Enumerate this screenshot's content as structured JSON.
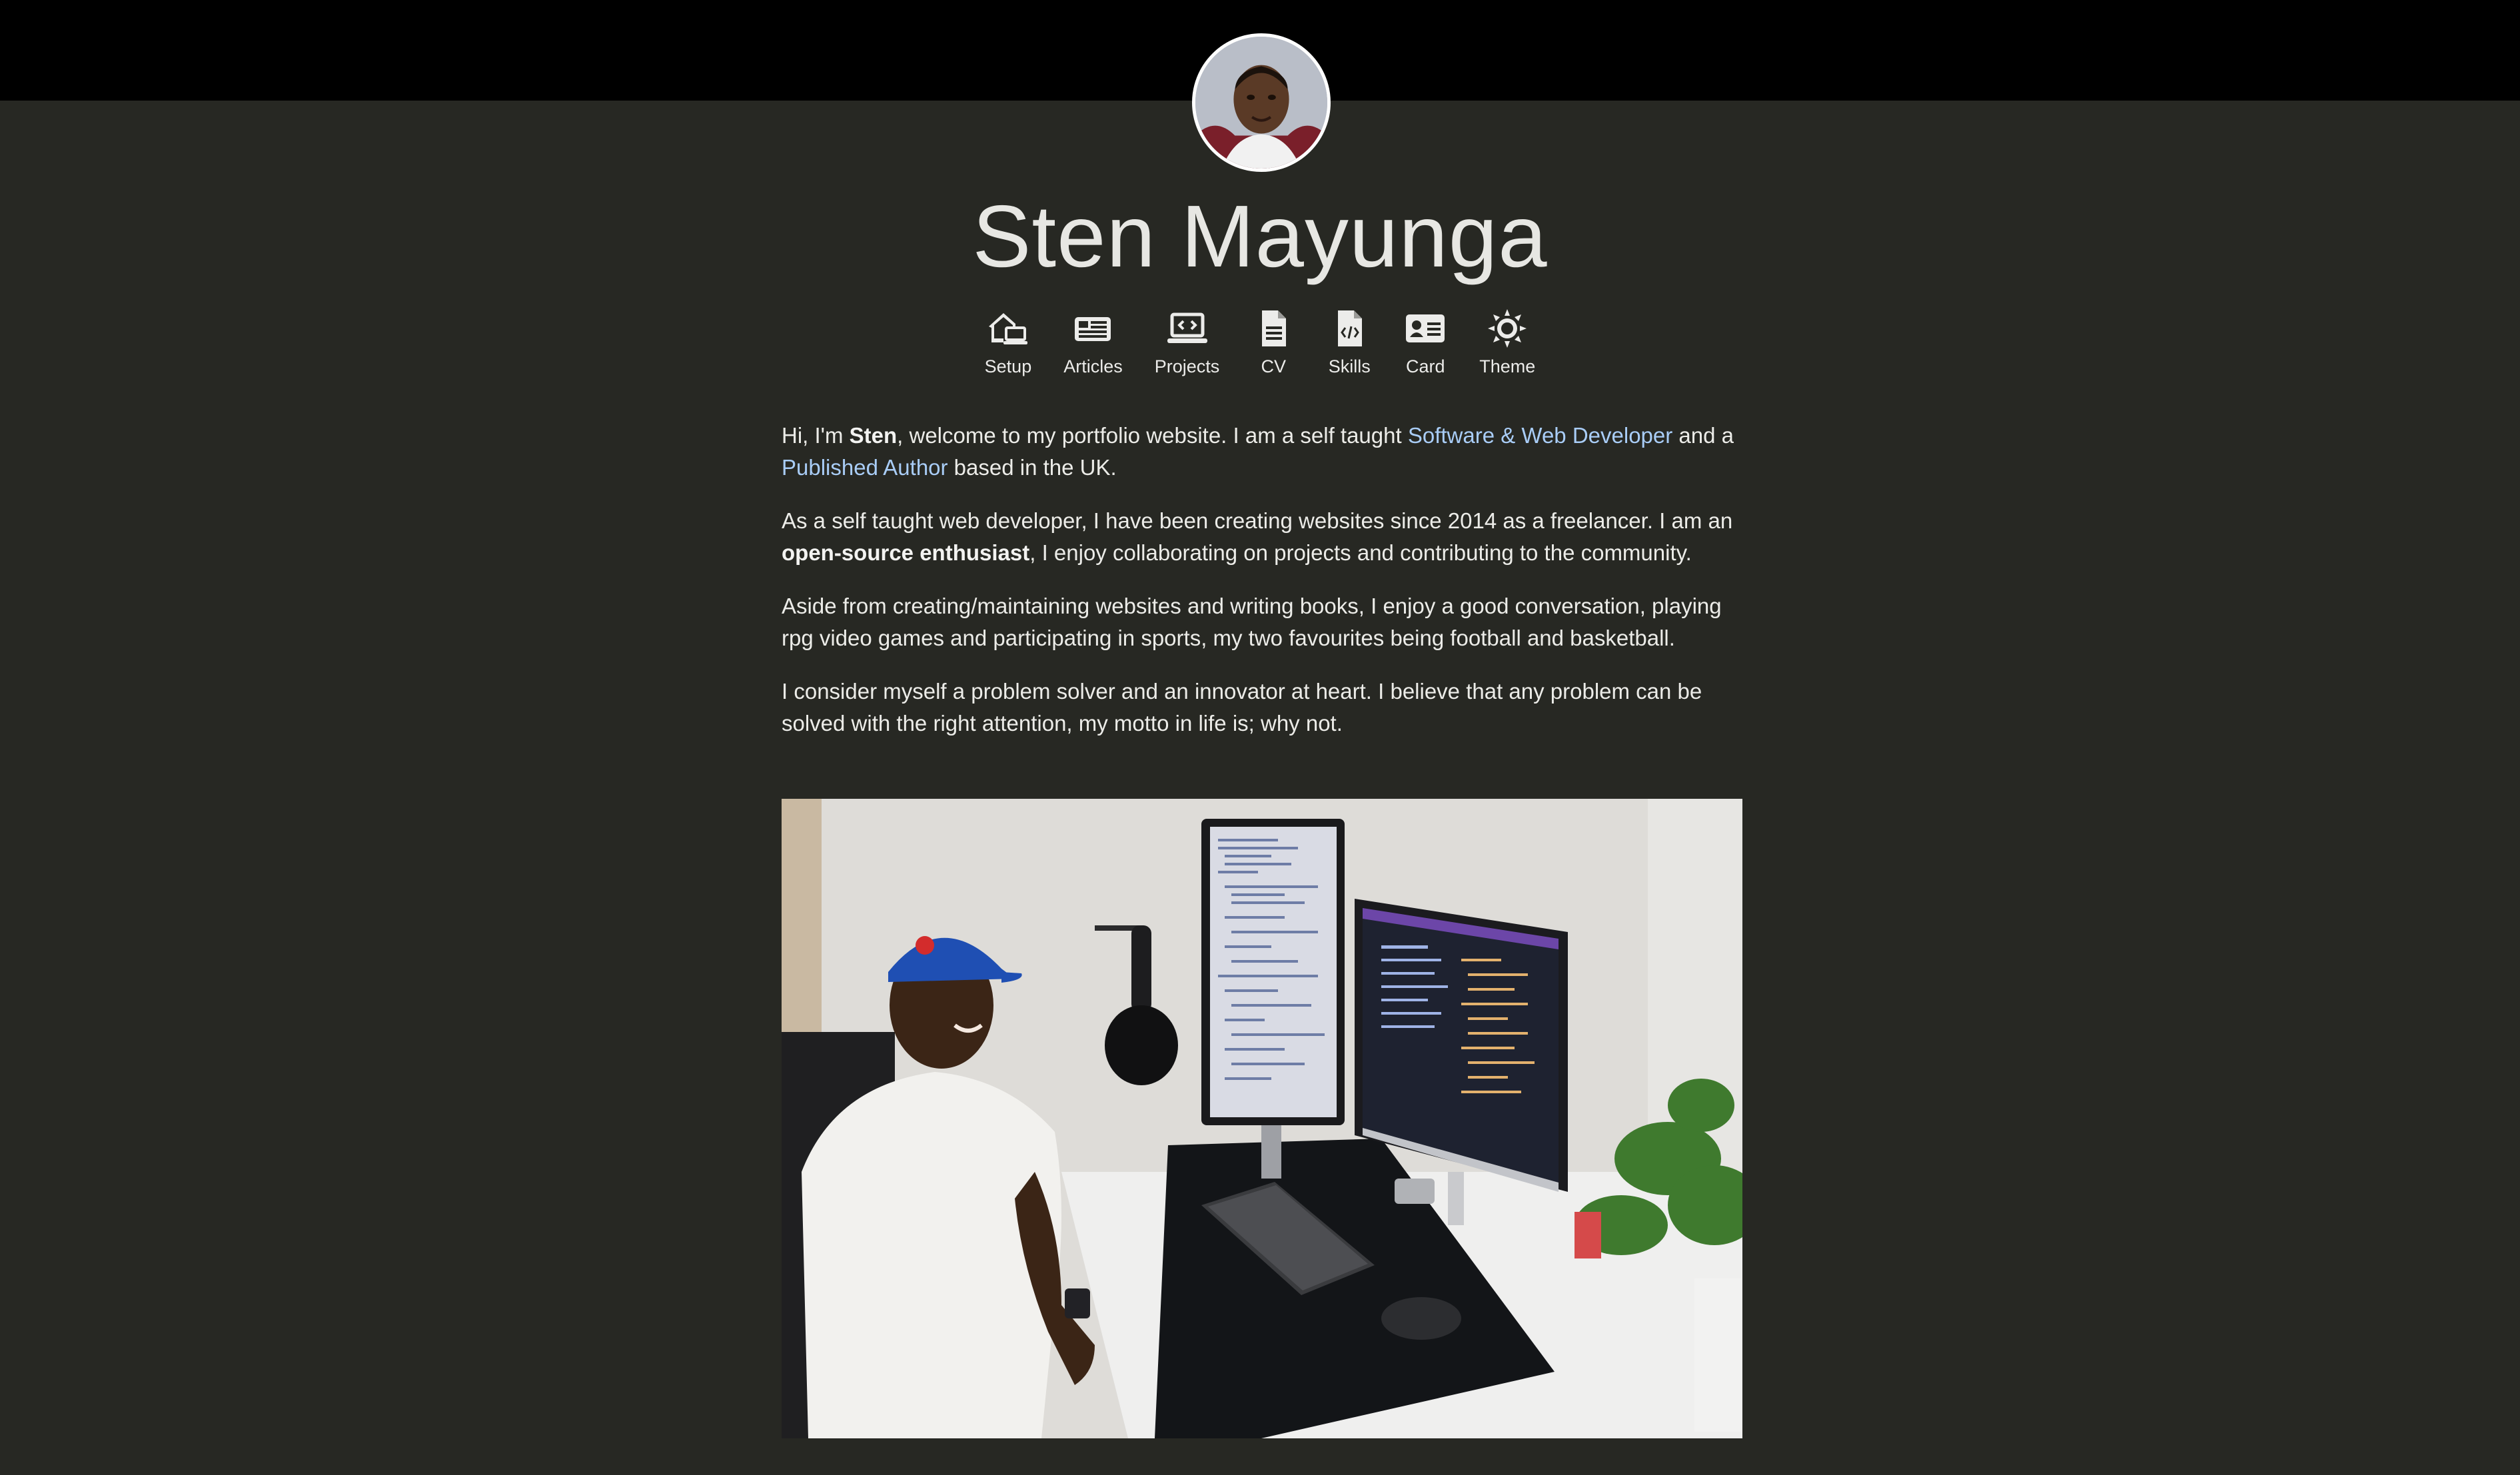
{
  "header": {
    "name": "Sten Mayunga"
  },
  "nav": {
    "items": [
      {
        "label": "Setup",
        "icon": "home-laptop-icon"
      },
      {
        "label": "Articles",
        "icon": "newspaper-icon"
      },
      {
        "label": "Projects",
        "icon": "laptop-code-icon"
      },
      {
        "label": "CV",
        "icon": "document-icon"
      },
      {
        "label": "Skills",
        "icon": "file-code-icon"
      },
      {
        "label": "Card",
        "icon": "id-card-icon"
      },
      {
        "label": "Theme",
        "icon": "sun-icon"
      }
    ]
  },
  "intro": {
    "p1": {
      "t1": "Hi, I'm ",
      "name_bold": "Sten",
      "t2": ", welcome to my portfolio website. I am a self taught ",
      "link1": "Software & Web Developer",
      "t3": " and a ",
      "link2": "Published Author",
      "t4": " based in the UK."
    },
    "p2": {
      "t1": "As a self taught web developer, I have been creating websites since 2014 as a freelancer. I am an ",
      "bold": "open-source enthusiast",
      "t2": ", I enjoy collaborating on projects and contributing to the community."
    },
    "p3": "Aside from creating/maintaining websites and writing books, I enjoy a good conversation, playing rpg video games and participating in sports, my two favourites being football and basketball.",
    "p4": "I consider myself a problem solver and an innovator at heart. I believe that any problem can be solved with the right attention, my motto in life is; why not."
  },
  "colors": {
    "background": "#272823",
    "topbar": "#000000",
    "text": "#ecece8",
    "link": "#a9cdf7"
  }
}
